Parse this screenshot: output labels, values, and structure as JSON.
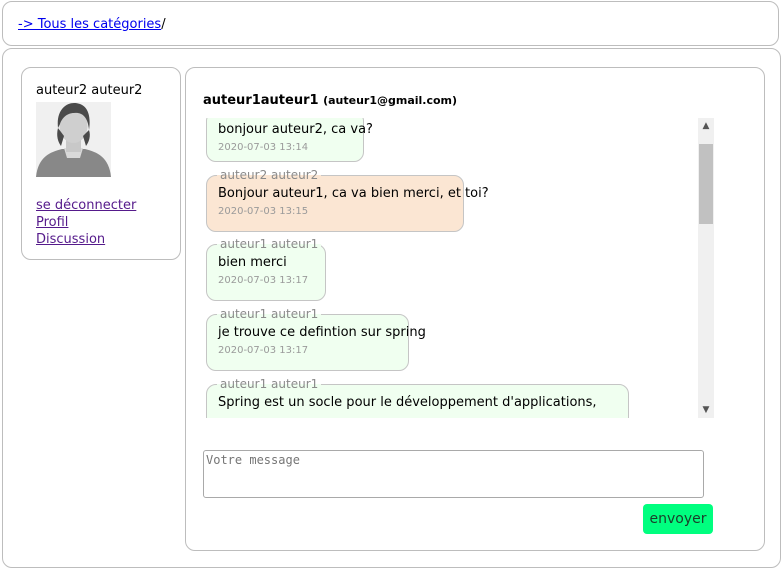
{
  "breadcrumb": {
    "link": "-> Tous les catégories",
    "separator": "/"
  },
  "profile": {
    "name": "auteur2 auteur2",
    "links": [
      "se déconnecter",
      "Profil",
      "Discussion"
    ]
  },
  "chat": {
    "header_name": "auteur1auteur1",
    "header_email": "(auteur1@gmail.com)",
    "messages": [
      {
        "author": "",
        "text": "bonjour auteur2, ca va?",
        "time": "2020-07-03 13:14",
        "color": "#f0fff0"
      },
      {
        "author": "auteur2 auteur2",
        "text": "Bonjour auteur1, ca va bien merci, et toi?",
        "time": "2020-07-03 13:15",
        "color": "#fbe6d3"
      },
      {
        "author": "auteur1 auteur1",
        "text": "bien merci",
        "time": "2020-07-03 13:17",
        "color": "#f0fff0"
      },
      {
        "author": "auteur1 auteur1",
        "text": "je trouve ce defintion sur spring",
        "time": "2020-07-03 13:17",
        "color": "#f0fff0"
      },
      {
        "author": "auteur1 auteur1",
        "text": "Spring est un socle pour le développement d'applications,",
        "time": "",
        "color": "#f0fff0"
      }
    ],
    "input_placeholder": "Votre message",
    "send_label": "envoyer"
  },
  "icons": {
    "avatar": "user-avatar-icon",
    "scroll_up": "chevron-up-icon",
    "scroll_down": "chevron-down-icon"
  },
  "colors": {
    "send_button": "#00ff7f",
    "own_message": "#f0fff0",
    "other_message": "#fbe6d3",
    "link": "#0000ee"
  }
}
